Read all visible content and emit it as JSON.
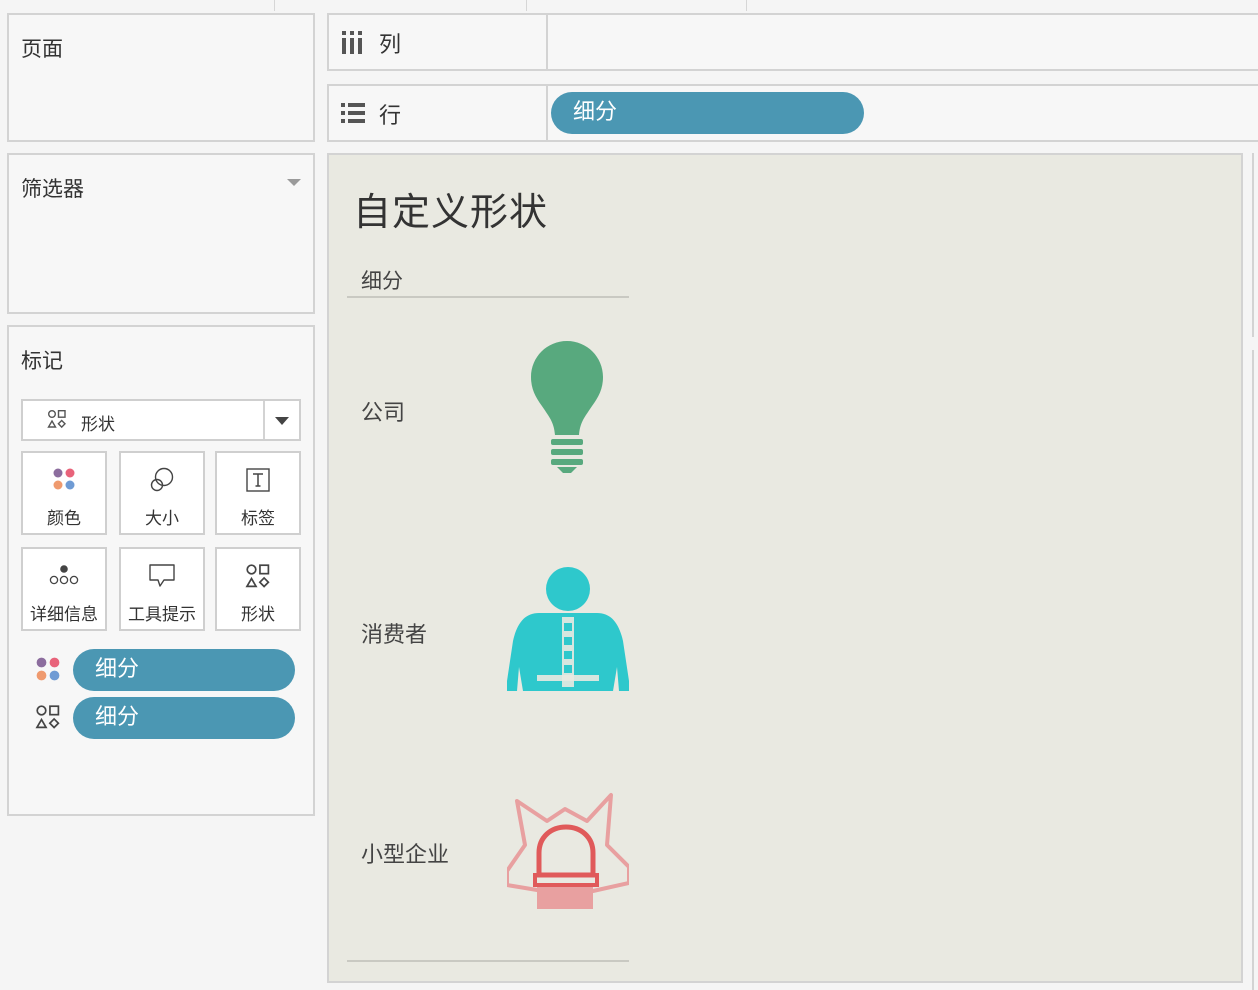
{
  "panels": {
    "pages_title": "页面",
    "filters_title": "筛选器",
    "marks_title": "标记"
  },
  "marks": {
    "mark_type": "形状",
    "buttons": [
      {
        "label": "颜色",
        "icon": "color-dots-icon"
      },
      {
        "label": "大小",
        "icon": "size-icon"
      },
      {
        "label": "标签",
        "icon": "label-icon"
      },
      {
        "label": "详细信息",
        "icon": "detail-icon"
      },
      {
        "label": "工具提示",
        "icon": "tooltip-icon"
      },
      {
        "label": "形状",
        "icon": "shape-icon"
      }
    ],
    "pills": [
      {
        "encoding": "color",
        "field": "细分"
      },
      {
        "encoding": "shape",
        "field": "细分"
      }
    ]
  },
  "shelves": {
    "columns_label": "列",
    "rows_label": "行",
    "rows_pill": "细分"
  },
  "view": {
    "title": "自定义形状",
    "row_header": "细分",
    "rows": [
      {
        "label": "公司",
        "shape": "lightbulb-icon",
        "color": "#58a97e"
      },
      {
        "label": "消费者",
        "shape": "person-icon",
        "color": "#2ec8cc"
      },
      {
        "label": "小型企业",
        "shape": "alarm-light-icon",
        "color": "#e06666"
      }
    ]
  },
  "colors": {
    "pill": "#4b97b3",
    "view_bg": "#e9e9e1"
  }
}
